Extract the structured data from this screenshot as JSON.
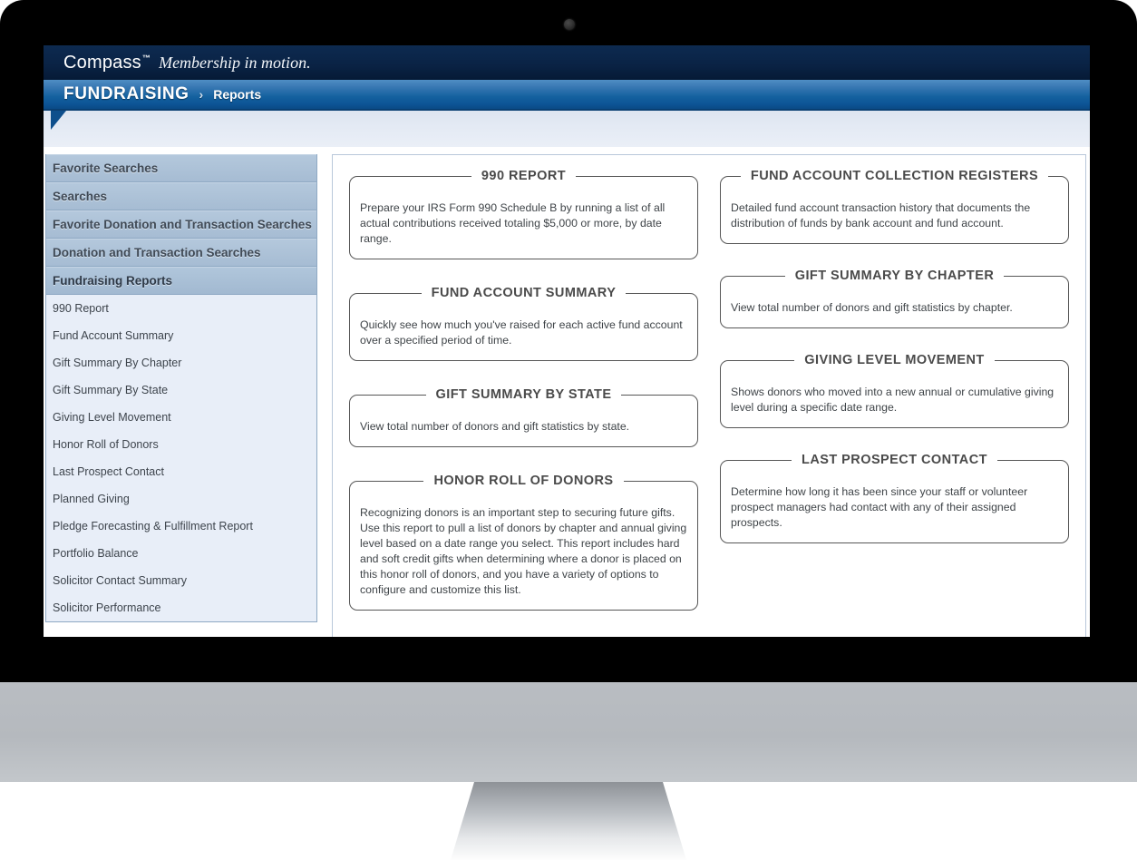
{
  "brand": {
    "name": "Compass",
    "trademark": "™",
    "tagline": "Membership in motion."
  },
  "nav": {
    "section": "FUNDRAISING",
    "separator": "›",
    "page": "Reports"
  },
  "sidebar": {
    "headers": [
      {
        "label": "Favorite Searches",
        "active": false
      },
      {
        "label": "Searches",
        "active": false
      },
      {
        "label": "Favorite Donation and Transaction Searches",
        "active": false
      },
      {
        "label": "Donation and Transaction Searches",
        "active": false
      },
      {
        "label": "Fundraising Reports",
        "active": true
      }
    ],
    "items": [
      "990 Report",
      "Fund Account Summary",
      "Gift Summary By Chapter",
      "Gift Summary By State",
      "Giving Level Movement",
      "Honor Roll of Donors",
      "Last Prospect Contact",
      "Planned Giving",
      "Pledge Forecasting & Fulfillment Report",
      "Portfolio Balance",
      "Solicitor Contact Summary",
      "Solicitor Performance"
    ]
  },
  "reports": {
    "left": [
      {
        "title": "990 REPORT",
        "description": "Prepare your IRS Form 990 Schedule B by running a list of all actual contributions received totaling $5,000 or more, by date range."
      },
      {
        "title": "FUND ACCOUNT SUMMARY",
        "description": "Quickly see how much you've raised for each active fund account over a specified period of time."
      },
      {
        "title": "GIFT SUMMARY BY STATE",
        "description": "View total number of donors and gift statistics by state."
      },
      {
        "title": "HONOR ROLL OF DONORS",
        "description": "Recognizing donors is an important step to securing future gifts. Use this report to pull a list of donors by chapter and annual giving level based on a date range you select. This report includes hard and soft credit gifts when determining where a donor is placed on this honor roll of donors, and you have a variety of options to configure and customize this list."
      }
    ],
    "right": [
      {
        "title": "FUND ACCOUNT COLLECTION REGISTERS",
        "description": "Detailed fund account transaction history that documents the distribution of funds by bank account and fund account."
      },
      {
        "title": "GIFT SUMMARY BY CHAPTER",
        "description": "View total number of donors and gift statistics by chapter."
      },
      {
        "title": "GIVING LEVEL MOVEMENT",
        "description": "Shows donors who moved into a new annual or cumulative giving level during a specific date range."
      },
      {
        "title": "LAST PROSPECT CONTACT",
        "description": "Determine how long it has been since your staff or volunteer prospect managers had contact with any of their assigned prospects."
      }
    ]
  },
  "colors": {
    "brand_bar": "#0a2345",
    "nav_bar": "#0d5596",
    "sidebar_header": "#a6bcd3",
    "sidebar_body": "#e8eef8",
    "card_border": "#565656"
  }
}
